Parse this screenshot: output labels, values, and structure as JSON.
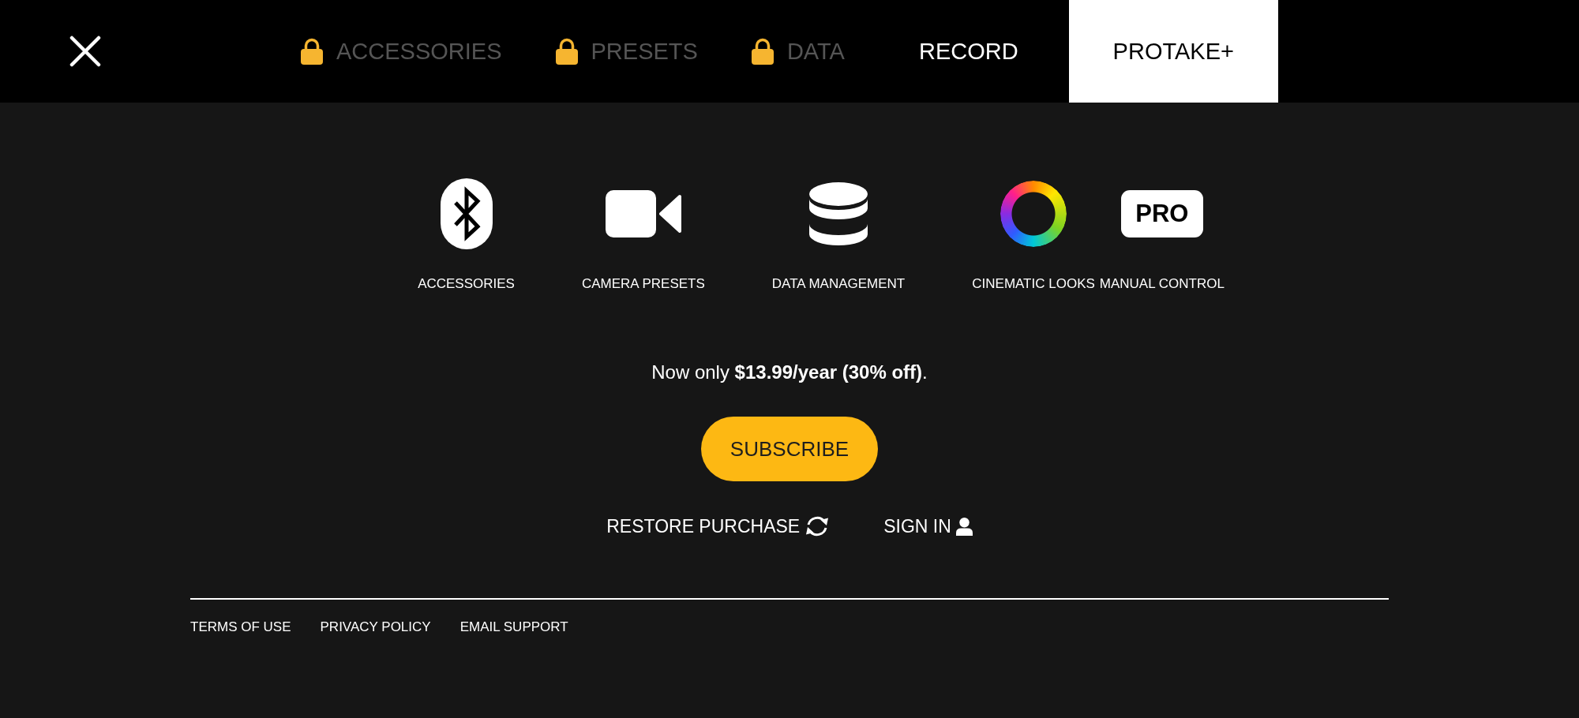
{
  "tabs": [
    {
      "label": "ACCESSORIES",
      "locked": true,
      "selected": false
    },
    {
      "label": "PRESETS",
      "locked": true,
      "selected": false
    },
    {
      "label": "DATA",
      "locked": true,
      "selected": false
    },
    {
      "label": "RECORD",
      "locked": false,
      "selected": false
    },
    {
      "label": "PROTAKE+",
      "locked": false,
      "selected": true
    }
  ],
  "features": [
    {
      "kind": "bluetooth",
      "label": "ACCESSORIES"
    },
    {
      "kind": "camera",
      "label": "CAMERA PRESETS"
    },
    {
      "kind": "database",
      "label": "DATA MANAGEMENT"
    },
    {
      "kind": "color-ring",
      "label": "CINEMATIC LOOKS"
    },
    {
      "kind": "badge",
      "badge": "PRO",
      "label": "MANUAL CONTROL"
    }
  ],
  "offer": {
    "text": "Now only **$13.99/year (30% off)**.",
    "button": "SUBSCRIBE"
  },
  "actions": [
    {
      "kind": "restore",
      "label": "RESTORE PURCHASE"
    },
    {
      "kind": "sign-in",
      "label": "SIGN IN"
    }
  ],
  "footer_links": [
    "TERMS OF USE",
    "PRIVACY POLICY",
    "EMAIL SUPPORT"
  ]
}
